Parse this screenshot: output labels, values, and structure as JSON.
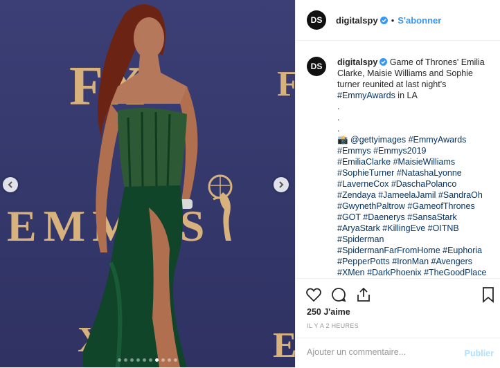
{
  "post": {
    "username": "digitalspy",
    "avatar_text": "DS",
    "separator": "•",
    "follow_label": "S'abonner",
    "caption_lines": [
      [
        {
          "t": "Game of Thrones' Emilia"
        }
      ],
      [
        {
          "t": "Clarke, Maisie Williams and Sophie"
        }
      ],
      [
        {
          "t": "turner reunited at last night's"
        }
      ],
      [
        {
          "t": "#EmmyAwards",
          "h": true
        },
        {
          "t": " in LA"
        }
      ],
      [
        {
          "t": "."
        }
      ],
      [
        {
          "t": "."
        }
      ],
      [
        {
          "t": "."
        }
      ],
      [
        {
          "t": "📸 "
        },
        {
          "t": "@gettyimages #EmmyAwards",
          "h": true
        }
      ],
      [
        {
          "t": "#Emmys #Emmys2019",
          "h": true
        }
      ],
      [
        {
          "t": "#EmiliaClarke #MaisieWilliams",
          "h": true
        }
      ],
      [
        {
          "t": "#SophieTurner #NatashaLyonne",
          "h": true
        }
      ],
      [
        {
          "t": "#LaverneCox #DaschaPolanco",
          "h": true
        }
      ],
      [
        {
          "t": "#Zendaya #JameelaJamil #SandraOh",
          "h": true
        }
      ],
      [
        {
          "t": "#GwynethPaltrow #GameofThrones",
          "h": true
        }
      ],
      [
        {
          "t": "#GOT #Daenerys #SansaStark",
          "h": true
        }
      ],
      [
        {
          "t": "#AryaStark #KillingEve #OITNB",
          "h": true
        }
      ],
      [
        {
          "t": "#Spiderman",
          "h": true
        }
      ],
      [
        {
          "t": "#SpidermanFarFromHome #Euphoria",
          "h": true
        }
      ],
      [
        {
          "t": "#PepperPotts #IronMan #Avengers",
          "h": true
        }
      ],
      [
        {
          "t": "#XMen #DarkPhoenix #TheGoodPlace",
          "h": true
        }
      ]
    ],
    "likes": "250 J'aime",
    "timestamp": "IL Y A 2 HEURES",
    "comment_placeholder": "Ajouter un commentaire...",
    "publish_label": "Publier"
  },
  "photo": {
    "backdrop": {
      "fx_a": "FX",
      "fx_b": "F",
      "emmys": "EMMYS",
      "fx_c": "E",
      "fx_d": "X"
    },
    "carousel_dots": 10,
    "active_dot": 6
  },
  "icons": [
    "verified-icon",
    "chevron-left-icon",
    "chevron-right-icon",
    "heart-icon",
    "comment-icon",
    "share-icon",
    "bookmark-icon"
  ],
  "colors": {
    "link": "#3897f0",
    "hashtag": "#003569",
    "text": "#262626",
    "muted": "#999999",
    "verified": "#3897f0"
  }
}
